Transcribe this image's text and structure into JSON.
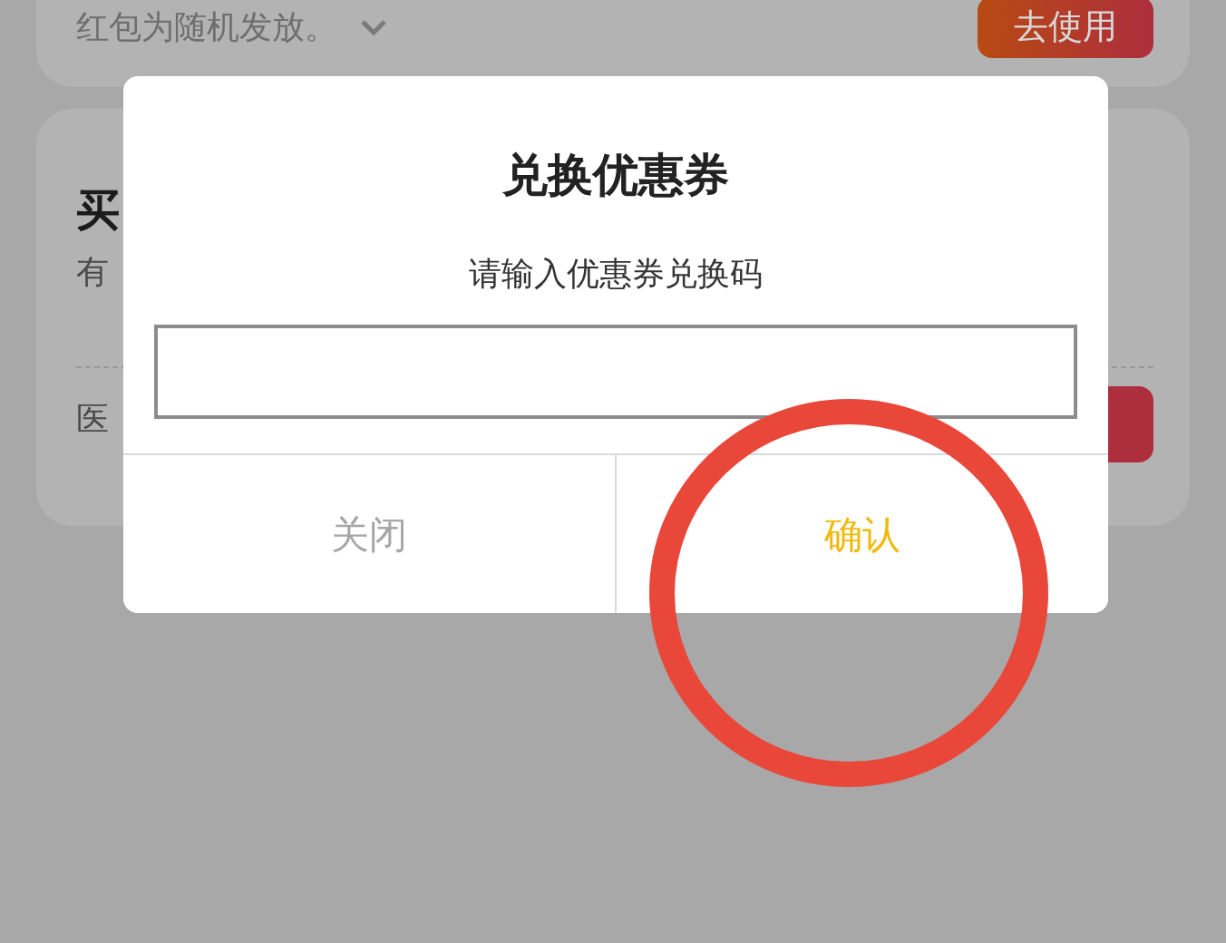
{
  "background": {
    "red_packet_card": {
      "note": "红包为随机发放。",
      "use_button": "去使用"
    },
    "second_card": {
      "title": "买",
      "line": "有",
      "footer": "医"
    }
  },
  "dialog": {
    "title": "兑换优惠券",
    "prompt": "请输入优惠券兑换码",
    "buttons": [
      {
        "kind": "cancel",
        "label": "关闭"
      },
      {
        "kind": "confirm",
        "label": "确认"
      }
    ]
  },
  "annotation": {
    "kind": "circle"
  }
}
